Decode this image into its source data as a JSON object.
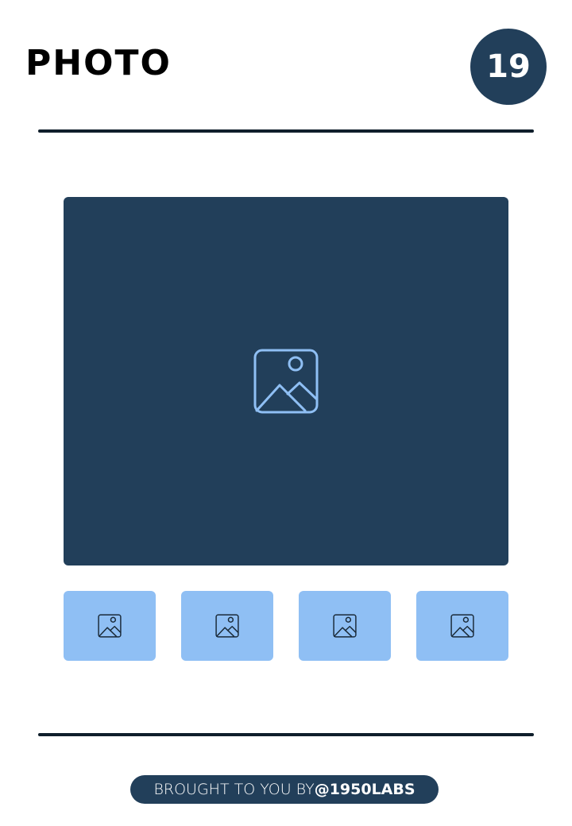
{
  "header": {
    "title": "PHOTO",
    "badge_number": "19"
  },
  "gallery": {
    "main_icon": "image-placeholder-icon",
    "thumbnails": [
      {
        "icon": "image-placeholder-icon"
      },
      {
        "icon": "image-placeholder-icon"
      },
      {
        "icon": "image-placeholder-icon"
      },
      {
        "icon": "image-placeholder-icon"
      }
    ]
  },
  "footer": {
    "lead_text": "BROUGHT TO YOU BY ",
    "handle": "@1950LABS"
  },
  "colors": {
    "navy": "#223f5a",
    "light_blue": "#8fbff4",
    "rule": "#0f1e2b"
  }
}
